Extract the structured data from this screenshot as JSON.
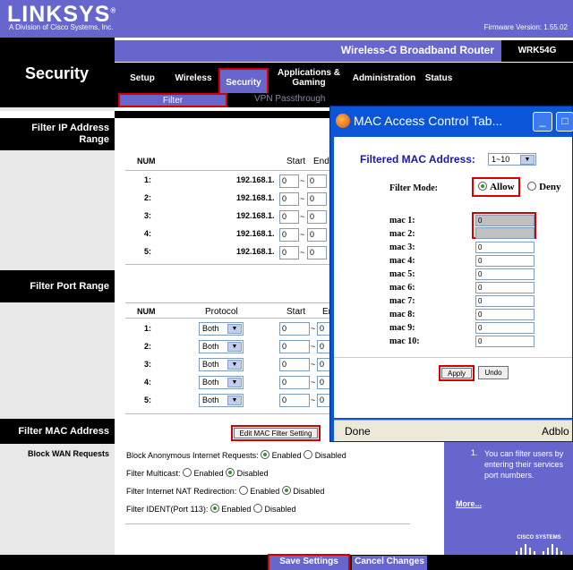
{
  "header": {
    "logo": "LINKSYS",
    "logo_reg": "®",
    "logo_sub": "A Division of Cisco Systems, Inc.",
    "firmware": "Firmware Version: 1.55.02",
    "product_name": "Wireless-G Broadband Router",
    "model": "WRK54G",
    "section_title": "Security"
  },
  "nav": {
    "tabs": [
      "Setup",
      "Wireless",
      "Security",
      "Applications & Gaming",
      "Administration",
      "Status"
    ],
    "active": "Security",
    "sub_tabs": [
      "Filter",
      "VPN Passthrough"
    ],
    "active_sub": "Filter"
  },
  "left": {
    "filter_ip": "Filter IP Address Range",
    "filter_port": "Filter Port Range",
    "filter_mac": "Filter MAC Address",
    "block_wan": "Block WAN Requests"
  },
  "ip_table": {
    "headers": [
      "NUM",
      "Start",
      "End"
    ],
    "prefix": "192.168.1.",
    "rows": [
      {
        "num": "1:",
        "start": "0",
        "end": "0"
      },
      {
        "num": "2:",
        "start": "0",
        "end": "0"
      },
      {
        "num": "3:",
        "start": "0",
        "end": "0"
      },
      {
        "num": "4:",
        "start": "0",
        "end": "0"
      },
      {
        "num": "5:",
        "start": "0",
        "end": "0"
      }
    ]
  },
  "port_table": {
    "headers": [
      "NUM",
      "Protocol",
      "Start",
      "End"
    ],
    "rows": [
      {
        "num": "1:",
        "protocol": "Both",
        "start": "0",
        "end": "0"
      },
      {
        "num": "2:",
        "protocol": "Both",
        "start": "0",
        "end": "0"
      },
      {
        "num": "3:",
        "protocol": "Both",
        "start": "0",
        "end": "0"
      },
      {
        "num": "4:",
        "protocol": "Both",
        "start": "0",
        "end": "0"
      },
      {
        "num": "5:",
        "protocol": "Both",
        "start": "0",
        "end": "0"
      }
    ],
    "tilde": "~"
  },
  "mac_button": "Edit MAC Filter Setting",
  "wan": {
    "items": [
      {
        "label": "Block Anonymous Internet Requests:",
        "selected": "Enabled"
      },
      {
        "label": "Filter Multicast:",
        "selected": "Disabled"
      },
      {
        "label": "Filter Internet NAT Redirection:",
        "selected": "Disabled"
      },
      {
        "label": "Filter IDENT(Port 113):",
        "selected": "Enabled"
      }
    ],
    "enabled": "Enabled",
    "disabled": "Disabled"
  },
  "help": {
    "text": "You can filter users by entering their services port numbers.",
    "bullet": "1.",
    "more": "More..."
  },
  "brand": "CISCO SYSTEMS",
  "footer": {
    "save": "Save Settings",
    "cancel": "Cancel Changes"
  },
  "popup": {
    "title": "MAC Access Control Tab...",
    "filtered_label": "Filtered MAC Address:",
    "range": "1~10",
    "filter_mode_label": "Filter Mode:",
    "allow": "Allow",
    "deny": "Deny",
    "mode_selected": "Allow",
    "macs": [
      {
        "label": "mac 1:",
        "value": "0"
      },
      {
        "label": "mac 2:",
        "value": ""
      },
      {
        "label": "mac 3:",
        "value": "0"
      },
      {
        "label": "mac 4:",
        "value": "0"
      },
      {
        "label": "mac 5:",
        "value": "0"
      },
      {
        "label": "mac 6:",
        "value": "0"
      },
      {
        "label": "mac 7:",
        "value": "0"
      },
      {
        "label": "mac 8:",
        "value": "0"
      },
      {
        "label": "mac 9:",
        "value": "0"
      },
      {
        "label": "mac 10:",
        "value": "0"
      }
    ],
    "apply": "Apply",
    "undo": "Undo",
    "status": "Done",
    "status_right": "Adblo",
    "minimize": "_",
    "maximize": "□"
  },
  "colors": {
    "accent": "#6666cc",
    "highlight": "#d40000",
    "popup_title": "#0a55d8"
  }
}
